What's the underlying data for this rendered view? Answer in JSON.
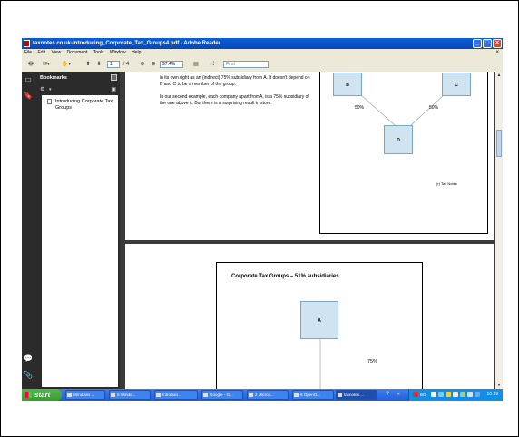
{
  "window": {
    "title": "taxnotes.co.uk-Introducing_Corporate_Tax_Groups4.pdf - Adobe Reader",
    "buttons": [
      "_",
      "□",
      "×"
    ]
  },
  "menu": [
    "File",
    "Edit",
    "View",
    "Document",
    "Tools",
    "Window",
    "Help"
  ],
  "menu_close": "×",
  "toolbar": {
    "page_current": "1",
    "page_total": "/ 4",
    "zoom": "97.4%",
    "find_placeholder": "Find"
  },
  "bookmarks": {
    "title": "Bookmarks",
    "options_label": "▾",
    "items": [
      {
        "label": "Introducing Corporate Tax Groups"
      }
    ]
  },
  "page1": {
    "para1": "in its own right as an (indirect) 75% subsidiary from A. It doesn't depend on B and C to be a member of the group.",
    "para2": "In our second example, each company apart fromA, is a 75% subsidiary of the one above it. But there is a surprising result in store.",
    "diagram": {
      "box_b": "B",
      "box_c": "C",
      "box_d": "D",
      "pct_left": "50%",
      "pct_right": "50%",
      "logo": "(r) Tax Notes"
    }
  },
  "page2": {
    "slide_title": "Corporate Tax Groups – 51% subsidiaries",
    "box_a": "A",
    "pct": "75%"
  },
  "taskbar": {
    "start": "start",
    "tasks": [
      {
        "label": "Windows ..."
      },
      {
        "label": "5 Windo..."
      },
      {
        "label": "Introduci..."
      },
      {
        "label": "Google - G..."
      },
      {
        "label": "2 Micros..."
      },
      {
        "label": "9 OpenO..."
      },
      {
        "label": "taxnotes...."
      }
    ],
    "tray_label": "BG",
    "clock": "10:19"
  }
}
